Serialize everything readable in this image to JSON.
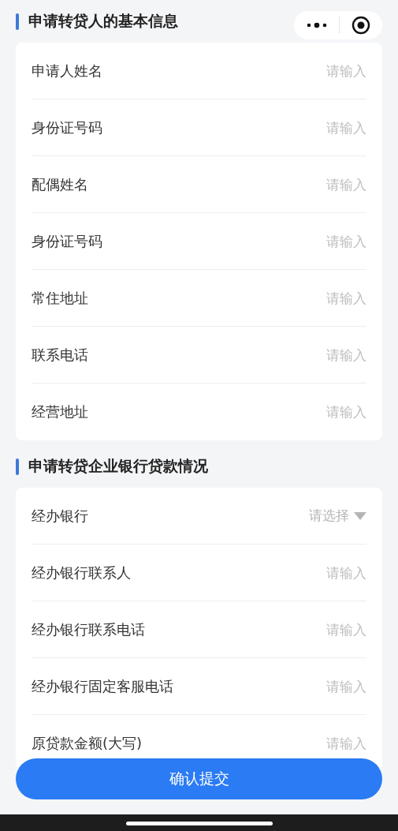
{
  "sections": [
    {
      "title": "申请转贷人的基本信息",
      "fields": [
        {
          "kind": "input",
          "label": "申请人姓名",
          "placeholder": "请输入"
        },
        {
          "kind": "input",
          "label": "身份证号码",
          "placeholder": "请输入"
        },
        {
          "kind": "input",
          "label": "配偶姓名",
          "placeholder": "请输入"
        },
        {
          "kind": "input",
          "label": "身份证号码",
          "placeholder": "请输入"
        },
        {
          "kind": "input",
          "label": "常住地址",
          "placeholder": "请输入"
        },
        {
          "kind": "input",
          "label": "联系电话",
          "placeholder": "请输入"
        },
        {
          "kind": "input",
          "label": "经营地址",
          "placeholder": "请输入"
        }
      ]
    },
    {
      "title": "申请转贷企业银行贷款情况",
      "fields": [
        {
          "kind": "select",
          "label": "经办银行",
          "placeholder": "请选择"
        },
        {
          "kind": "input",
          "label": "经办银行联系人",
          "placeholder": "请输入"
        },
        {
          "kind": "input",
          "label": "经办银行联系电话",
          "placeholder": "请输入"
        },
        {
          "kind": "input",
          "label": "经办银行固定客服电话",
          "placeholder": "请输入"
        },
        {
          "kind": "input",
          "label": "原贷款金额(大写)",
          "placeholder": "请输入"
        }
      ]
    }
  ],
  "submit_button": "确认提交"
}
